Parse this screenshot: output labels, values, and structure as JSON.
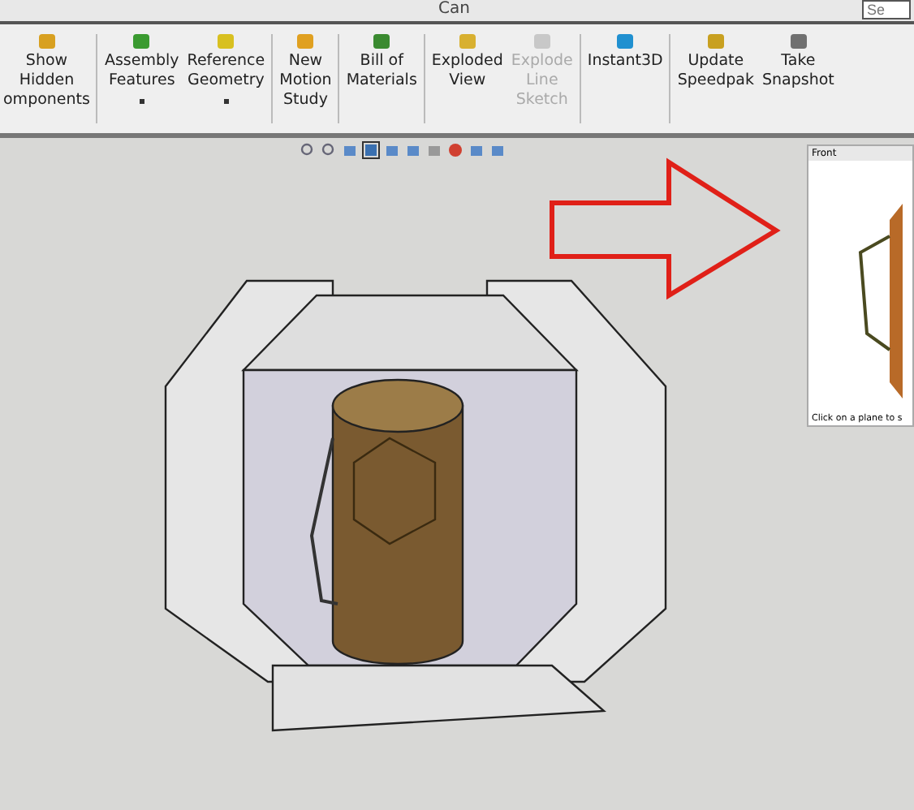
{
  "window": {
    "title": "Can",
    "search": {
      "placeholder": "Se"
    }
  },
  "ribbon": {
    "groups": [
      {
        "buttons": [
          {
            "label": "Show\nHidden\nomponents",
            "disabled": false,
            "dropdown": false
          }
        ]
      },
      {
        "buttons": [
          {
            "label": "Assembly\nFeatures",
            "disabled": false,
            "dropdown": true
          },
          {
            "label": "Reference\nGeometry",
            "disabled": false,
            "dropdown": true
          }
        ]
      },
      {
        "buttons": [
          {
            "label": "New\nMotion\nStudy",
            "disabled": false,
            "dropdown": false
          }
        ]
      },
      {
        "buttons": [
          {
            "label": "Bill of\nMaterials",
            "disabled": false,
            "dropdown": false
          }
        ]
      },
      {
        "buttons": [
          {
            "label": "Exploded\nView",
            "disabled": false,
            "dropdown": false
          },
          {
            "label": "Explode\nLine\nSketch",
            "disabled": true,
            "dropdown": false
          }
        ]
      },
      {
        "buttons": [
          {
            "label": "Instant3D",
            "disabled": false,
            "dropdown": false
          }
        ]
      },
      {
        "buttons": [
          {
            "label": "Update\nSpeedpak",
            "disabled": false,
            "dropdown": false
          },
          {
            "label": "Take\nSnapshot",
            "disabled": false,
            "dropdown": false
          }
        ]
      }
    ]
  },
  "preview": {
    "title": "Front",
    "caption": "Click on a plane to s"
  }
}
